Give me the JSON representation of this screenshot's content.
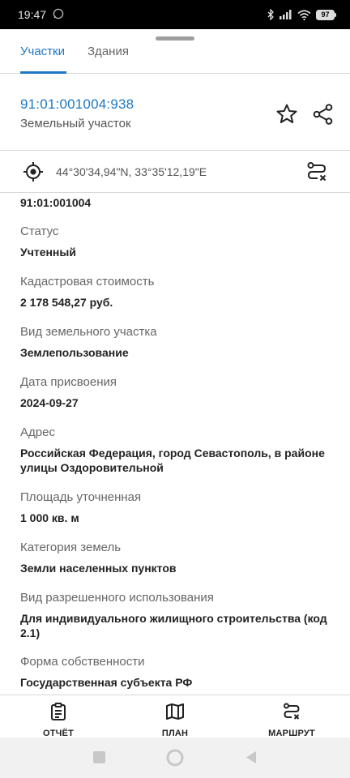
{
  "status_bar": {
    "time": "19:47",
    "battery": "97",
    "icons": [
      "whatsapp-icon",
      "bluetooth-icon",
      "signal-icon",
      "wifi-icon",
      "battery-icon"
    ]
  },
  "tabs": [
    {
      "label": "Участки",
      "active": true
    },
    {
      "label": "Здания",
      "active": false
    }
  ],
  "header": {
    "cadastral_number": "91:01:001004:938",
    "object_type": "Земельный участок"
  },
  "location": {
    "coordinates": "44°30'34,94\"N, 33°35'12,19\"E"
  },
  "details": {
    "quarter_number": "91:01:001004",
    "fields": [
      {
        "label": "Статус",
        "value": "Учтенный"
      },
      {
        "label": "Кадастровая стоимость",
        "value": "2 178 548,27 руб."
      },
      {
        "label": "Вид земельного участка",
        "value": "Землепользование"
      },
      {
        "label": "Дата присвоения",
        "value": "2024-09-27"
      },
      {
        "label": "Адрес",
        "value": "Российская Федерация, город Севастополь, в районе улицы Оздоровительной"
      },
      {
        "label": "Площадь уточненная",
        "value": "1 000 кв. м"
      },
      {
        "label": "Категория земель",
        "value": "Земли населенных пунктов"
      },
      {
        "label": "Вид разрешенного использования",
        "value": "Для индивидуального жилищного строительства (код 2.1)"
      },
      {
        "label": "Форма собственности",
        "value": "Государственная субъекта РФ"
      }
    ]
  },
  "bottom_nav": [
    {
      "label": "ОТЧЁТ",
      "icon": "report-icon"
    },
    {
      "label": "ПЛАН",
      "icon": "map-icon"
    },
    {
      "label": "МАРШРУТ",
      "icon": "route-icon"
    }
  ],
  "colors": {
    "accent": "#1e78c2",
    "text_primary": "#222222",
    "text_secondary": "#666666",
    "divider": "#d8d8d8"
  }
}
